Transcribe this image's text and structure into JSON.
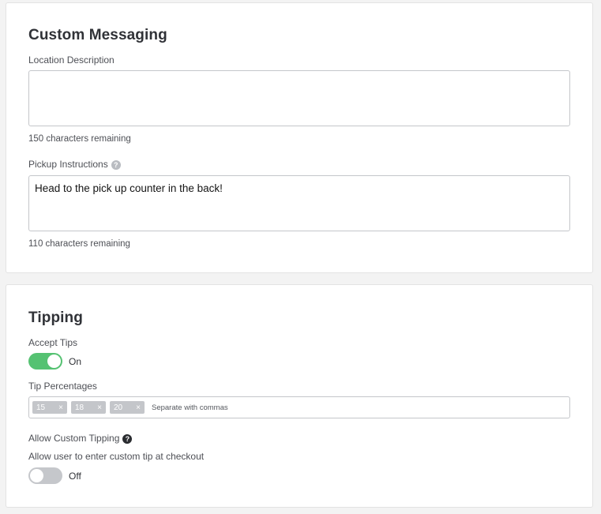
{
  "custom_messaging": {
    "title": "Custom Messaging",
    "location_description": {
      "label": "Location Description",
      "value": "",
      "remaining": "150 characters remaining"
    },
    "pickup_instructions": {
      "label": "Pickup Instructions",
      "help_icon": "?",
      "value": "Head to the pick up counter in the back!",
      "remaining": "110 characters remaining"
    }
  },
  "tipping": {
    "title": "Tipping",
    "accept_tips": {
      "label": "Accept Tips",
      "state": "On"
    },
    "tip_percentages": {
      "label": "Tip Percentages",
      "tags": [
        "15",
        "18",
        "20"
      ],
      "remove_glyph": "×",
      "placeholder": "Separate with commas"
    },
    "custom_tipping": {
      "label": "Allow Custom Tipping",
      "help_icon": "?",
      "description": "Allow user to enter custom tip at checkout",
      "state": "Off"
    }
  },
  "colors": {
    "toggle_on": "#55c272",
    "toggle_off": "#c5c7cb",
    "tag_bg": "#c4c6ca"
  }
}
